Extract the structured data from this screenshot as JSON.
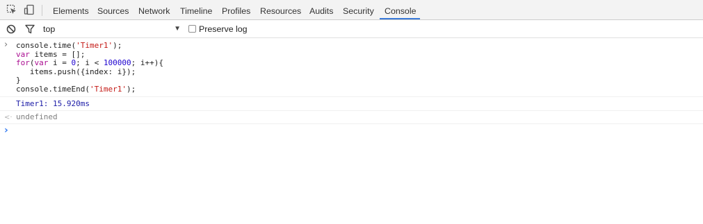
{
  "devtools": {
    "tabs": [
      {
        "label": "Elements"
      },
      {
        "label": "Sources"
      },
      {
        "label": "Network"
      },
      {
        "label": "Timeline"
      },
      {
        "label": "Profiles"
      },
      {
        "label": "Resources"
      },
      {
        "label": "Audits"
      },
      {
        "label": "Security"
      },
      {
        "label": "Console"
      }
    ],
    "active_tab": "Console",
    "accent_color": "#3879d9",
    "icons": [
      "inspect-element-icon",
      "device-mode-icon",
      "clear-console-icon",
      "filter-icon",
      "dropdown-arrow-icon"
    ]
  },
  "filterbar": {
    "context": "top",
    "dropdown_arrow": "▼",
    "preserve_log_label": "Preserve log",
    "preserve_log_checked": false
  },
  "console": {
    "input_caret": "›",
    "input_lines": [
      [
        {
          "t": "console.time(",
          "c": ""
        },
        {
          "t": "'Timer1'",
          "c": "str"
        },
        {
          "t": ");",
          "c": ""
        }
      ],
      [
        {
          "t": "var",
          "c": "kw"
        },
        {
          "t": " items = [];",
          "c": ""
        }
      ],
      [
        {
          "t": "for",
          "c": "kw"
        },
        {
          "t": "(",
          "c": ""
        },
        {
          "t": "var",
          "c": "kw"
        },
        {
          "t": " i = ",
          "c": ""
        },
        {
          "t": "0",
          "c": "num"
        },
        {
          "t": "; i < ",
          "c": ""
        },
        {
          "t": "100000",
          "c": "num"
        },
        {
          "t": "; i++){",
          "c": ""
        }
      ],
      [
        {
          "t": "   items.push({index: i});",
          "c": ""
        }
      ],
      [
        {
          "t": "}",
          "c": ""
        }
      ],
      [
        {
          "t": "console.timeEnd(",
          "c": ""
        },
        {
          "t": "'Timer1'",
          "c": "str"
        },
        {
          "t": ");",
          "c": ""
        }
      ]
    ],
    "log_output": "Timer1: 15.920ms",
    "log_color": "#1a1aa6",
    "result_arrow": "<·",
    "result_value": "undefined",
    "result_color": "#808080",
    "prompt_symbol": "›",
    "prompt_color": "#367cf1"
  }
}
